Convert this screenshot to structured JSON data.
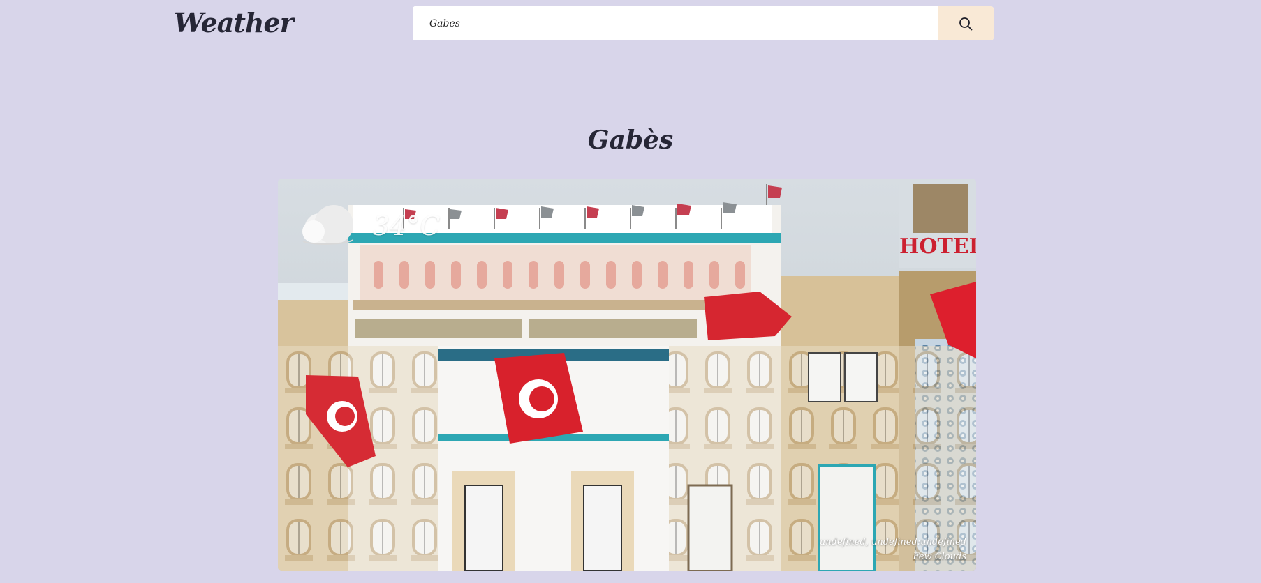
{
  "header": {
    "logo": "Weather"
  },
  "search": {
    "value": "Gabes",
    "placeholder": ""
  },
  "icons": {
    "search": "search-icon",
    "weather": "few-clouds-icon"
  },
  "main": {
    "city": "Gabès",
    "temperature": "34°C",
    "datetime": "undefined, undefined:undefined",
    "condition": "Few Clouds"
  },
  "colors": {
    "background": "#d8d5ea",
    "text": "#262636",
    "search_button": "#f9e9d6"
  }
}
